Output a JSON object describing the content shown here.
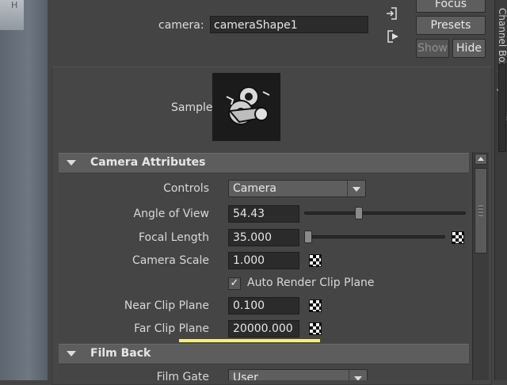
{
  "header": {
    "camera_label": "camera:",
    "camera_value": "cameraShape1",
    "focus_label": "Focus",
    "presets_label": "Presets",
    "show_label": "Show",
    "hide_label": "Hide"
  },
  "sample": {
    "label": "Sample"
  },
  "camera_attributes": {
    "title": "Camera Attributes",
    "controls": {
      "label": "Controls",
      "value": "Camera"
    },
    "angle_of_view": {
      "label": "Angle of View",
      "value": "54.43",
      "slider_fraction": 0.33
    },
    "focal_length": {
      "label": "Focal Length",
      "value": "35.000",
      "slider_fraction": 0.0
    },
    "camera_scale": {
      "label": "Camera Scale",
      "value": "1.000"
    },
    "auto_render_clip_plane": {
      "label": "Auto Render Clip Plane",
      "checked": true
    },
    "near_clip_plane": {
      "label": "Near Clip Plane",
      "value": "0.100"
    },
    "far_clip_plane": {
      "label": "Far Clip Plane",
      "value": "20000.000"
    }
  },
  "film_back": {
    "title": "Film Back",
    "film_gate": {
      "label": "Film Gate",
      "value": "User"
    }
  },
  "side_tab": {
    "label": "Channel Box / Layer Editor"
  },
  "viewport": {
    "corner_text": "H"
  },
  "icons": {
    "load_icon": "arrow-into-bracket",
    "save_icon": "arrow-out-bracket"
  }
}
